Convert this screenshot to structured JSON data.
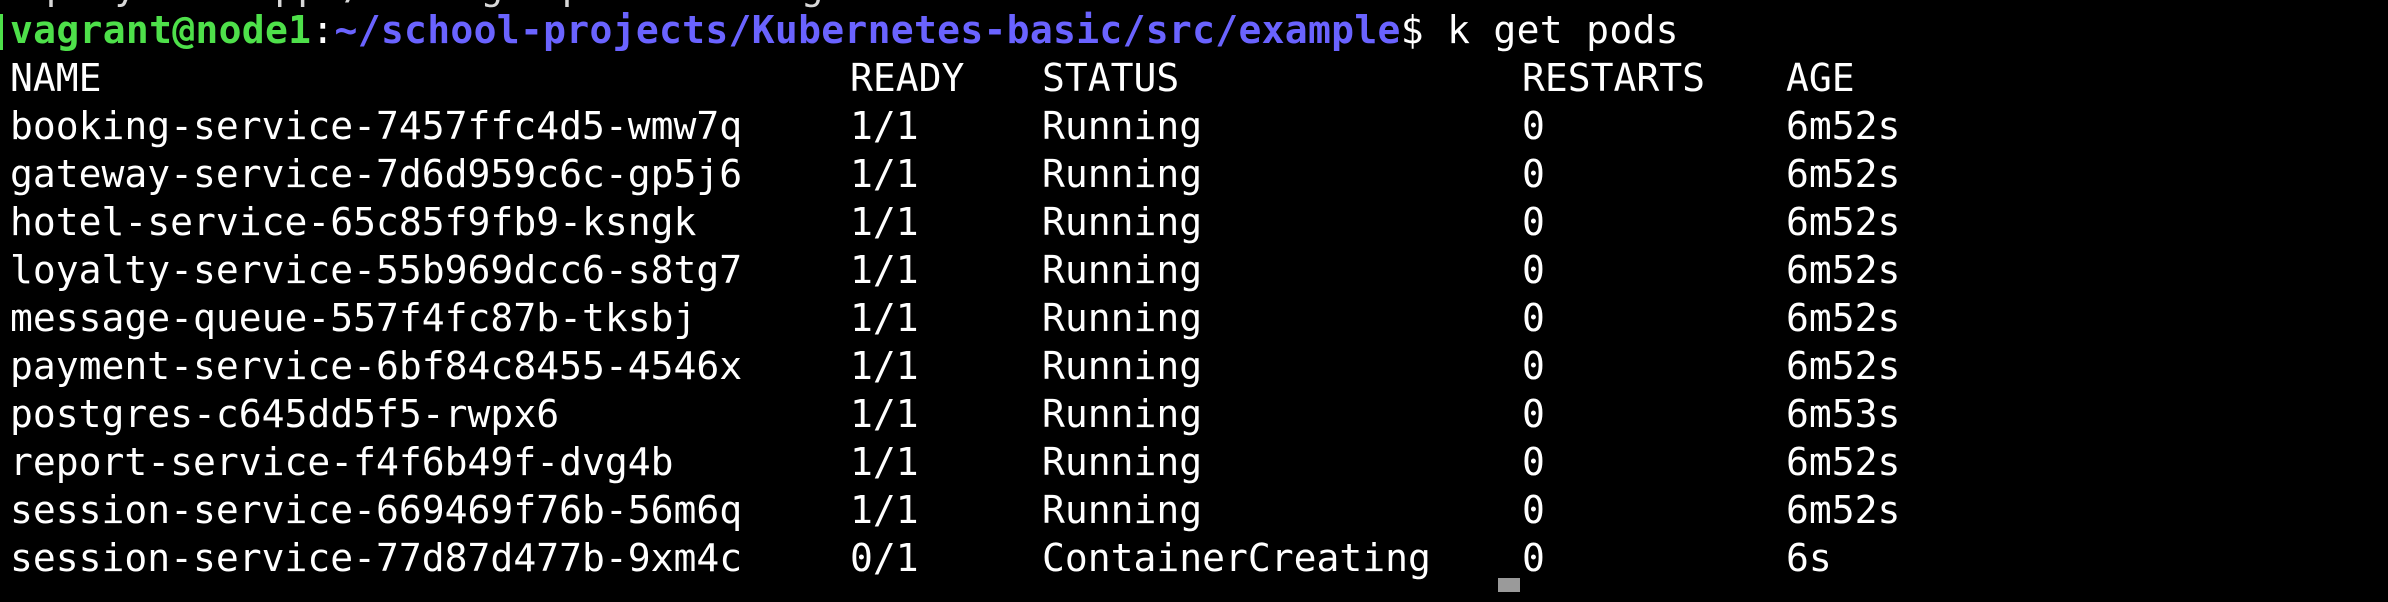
{
  "terminal": {
    "partial_top_line": "deployment.apps/message-queue configured",
    "prompt": {
      "user_host": "vagrant@node1",
      "separator": ":",
      "path": "~/school-projects/Kubernetes-basic/src/example",
      "sign": "$",
      "command": " k get pods"
    },
    "table": {
      "headers": {
        "name": "NAME",
        "ready": "READY",
        "status": "STATUS",
        "restarts": "RESTARTS",
        "age": "AGE"
      },
      "rows": [
        {
          "name": "booking-service-7457ffc4d5-wmw7q",
          "ready": "1/1",
          "status": "Running",
          "restarts": "0",
          "age": "6m52s"
        },
        {
          "name": "gateway-service-7d6d959c6c-gp5j6",
          "ready": "1/1",
          "status": "Running",
          "restarts": "0",
          "age": "6m52s"
        },
        {
          "name": "hotel-service-65c85f9fb9-ksngk",
          "ready": "1/1",
          "status": "Running",
          "restarts": "0",
          "age": "6m52s"
        },
        {
          "name": "loyalty-service-55b969dcc6-s8tg7",
          "ready": "1/1",
          "status": "Running",
          "restarts": "0",
          "age": "6m52s"
        },
        {
          "name": "message-queue-557f4fc87b-tksbj",
          "ready": "1/1",
          "status": "Running",
          "restarts": "0",
          "age": "6m52s"
        },
        {
          "name": "payment-service-6bf84c8455-4546x",
          "ready": "1/1",
          "status": "Running",
          "restarts": "0",
          "age": "6m52s"
        },
        {
          "name": "postgres-c645dd5f5-rwpx6",
          "ready": "1/1",
          "status": "Running",
          "restarts": "0",
          "age": "6m53s"
        },
        {
          "name": "report-service-f4f6b49f-dvg4b",
          "ready": "1/1",
          "status": "Running",
          "restarts": "0",
          "age": "6m52s"
        },
        {
          "name": "session-service-669469f76b-56m6q",
          "ready": "1/1",
          "status": "Running",
          "restarts": "0",
          "age": "6m52s"
        },
        {
          "name": "session-service-77d87d477b-9xm4c",
          "ready": "0/1",
          "status": "ContainerCreating",
          "restarts": "0",
          "age": "6s"
        }
      ]
    },
    "colors": {
      "background": "#000000",
      "text": "#ffffff",
      "user_host": "#4ee04a",
      "path": "#6a63ff"
    }
  }
}
